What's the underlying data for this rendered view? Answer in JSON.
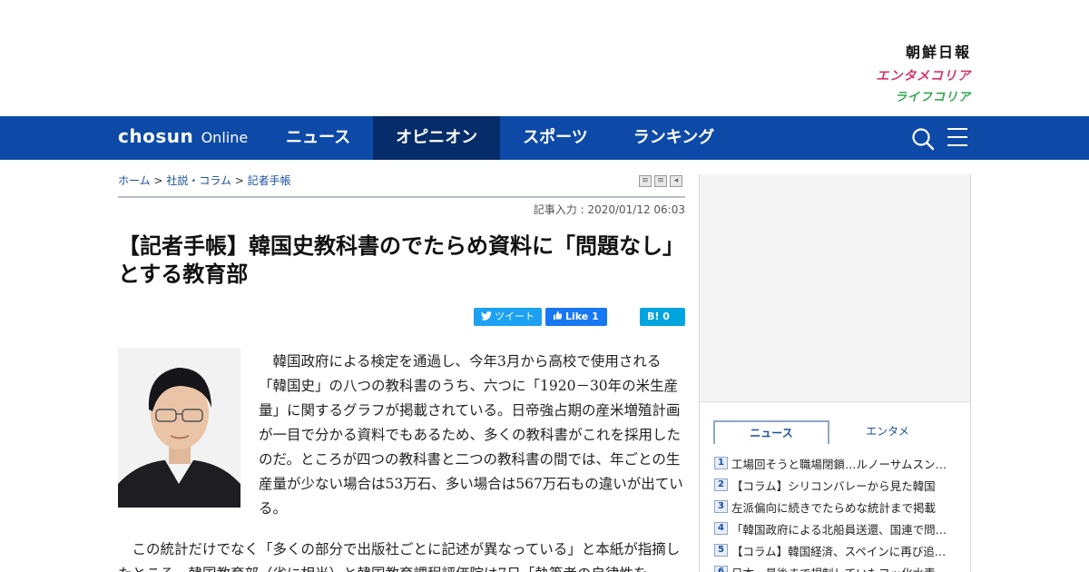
{
  "header": {
    "logo_main": "朝鮮日報",
    "logo_ent": "エンタメコリア",
    "logo_life": "ライフコリア"
  },
  "nav": {
    "brand_bold": "chosun",
    "brand_light": "Online",
    "items": [
      {
        "label": "ニュース"
      },
      {
        "label": "オピニオン"
      },
      {
        "label": "スポーツ"
      },
      {
        "label": "ランキング"
      }
    ],
    "active_index": 1
  },
  "breadcrumb": {
    "home": "ホーム",
    "sep1": " > ",
    "section": "社説・コラム",
    "sep2": " > ",
    "current": "記者手帳"
  },
  "article": {
    "date": "記事入力 : 2020/01/12 06:03",
    "title": "【記者手帳】韓国史教科書のでたらめ資料に「問題なし」とする教育部",
    "share": {
      "tweet": "ツイート",
      "like": "Like 1",
      "hatena": "B! 0"
    },
    "paragraph1": "　韓国政府による検定を通過し、今年3月から高校で使用される「韓国史」の八つの教科書のうち、六つに「1920－30年の米生産量」に関するグラフが掲載されている。日帝強占期の産米増殖計画が一目で分かる資料でもあるため、多くの教科書がこれを採用したのだ。ところが四つの教科書と二つの教科書の間では、年ごとの生産量が少ない場合は53万石、多い場合は567万石もの違いが出ている。",
    "paragraph2": "　この統計だけでなく「多くの部分で出版社ごとに記述が異なっている」と本紙が指摘したところ、韓国教育部（省に相当）と韓国教育課程評価院は7日「執筆者の自律性を"
  },
  "sidebar": {
    "tabs": [
      "ニュース",
      "エンタメ"
    ],
    "news": [
      {
        "num": "1",
        "text": "工場回そうと職場閉鎖…ルノーサムスン労組"
      },
      {
        "num": "2",
        "text": "【コラム】シリコンバレーから見た韓国"
      },
      {
        "num": "3",
        "text": "左派偏向に続きでたらめな統計まで掲載"
      },
      {
        "num": "4",
        "text": "「韓国政府による北船員送還、国連で問題に」"
      },
      {
        "num": "5",
        "text": "【コラム】韓国経済、スペインに再び追い越される"
      },
      {
        "num": "6",
        "text": "日本、最後まで規制していたフッ化水素も解除"
      }
    ]
  },
  "colors": {
    "nav_bg": "#0d4aa8",
    "nav_active": "#062c6a",
    "link": "#1b4fa0"
  }
}
